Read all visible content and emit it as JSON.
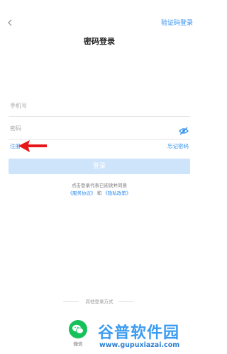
{
  "header": {
    "back_icon": "chevron-left-icon",
    "switch_label": "验证码登录"
  },
  "title": "密码登录",
  "form": {
    "phone_placeholder": "手机号",
    "password_placeholder": "密码",
    "eye_icon": "eye-slash-icon",
    "register_label": "注册",
    "forgot_label": "忘记密码",
    "login_label": "登录"
  },
  "agreement": {
    "line1": "点击登录代表已阅读并同意",
    "service_label": "《服务协议》",
    "and_label": "和",
    "privacy_label": "《隐私政策》"
  },
  "other_login": {
    "label": "其他登录方式",
    "wechat_label": "微信",
    "wechat_icon": "wechat-icon"
  },
  "watermark": {
    "name": "谷普软件园",
    "url": "www.gupuxiazai.com"
  },
  "colors": {
    "accent": "#2e8ef0",
    "button_disabled": "#cde4fb",
    "wechat": "#16c15a",
    "arrow": "#e8151b"
  }
}
